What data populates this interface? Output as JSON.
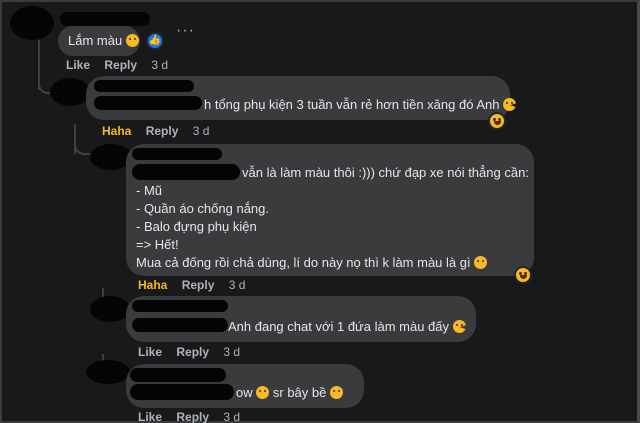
{
  "comments": [
    {
      "text": "Lắm màu",
      "actions": {
        "like": "Like",
        "reply": "Reply",
        "time": "3 d"
      },
      "more": "···"
    },
    {
      "text": "h tổng phụ kiện 3 tuần vẫn rẻ hơn tiền xăng đó Anh",
      "actions": {
        "reaction": "Haha",
        "reply": "Reply",
        "time": "3 d"
      }
    },
    {
      "lines": [
        "vẫn là làm màu thôi :))) chứ đạp xe nói thẳng cần:",
        "- Mũ",
        "- Quần áo chống nắng.",
        "- Balo đựng phụ kiện",
        "=> Hết!",
        "Mua cả đống rồi chả dùng, lí do này nọ thì k làm màu là gì"
      ],
      "actions": {
        "reaction": "Haha",
        "reply": "Reply",
        "time": "3 d"
      }
    },
    {
      "text": "Anh đang chat với 1 đứa làm màu đấy",
      "actions": {
        "like": "Like",
        "reply": "Reply",
        "time": "3 d"
      }
    },
    {
      "text": "ow",
      "text2": "sr bây bề",
      "actions": {
        "like": "Like",
        "reply": "Reply",
        "time": "3 d"
      }
    }
  ],
  "colors": {
    "background": "#18191a",
    "bubble": "#3a3b3c",
    "text": "#e4e6eb",
    "meta": "#b0b3b8",
    "haha": "#f7b928",
    "like": "#1877f2"
  }
}
